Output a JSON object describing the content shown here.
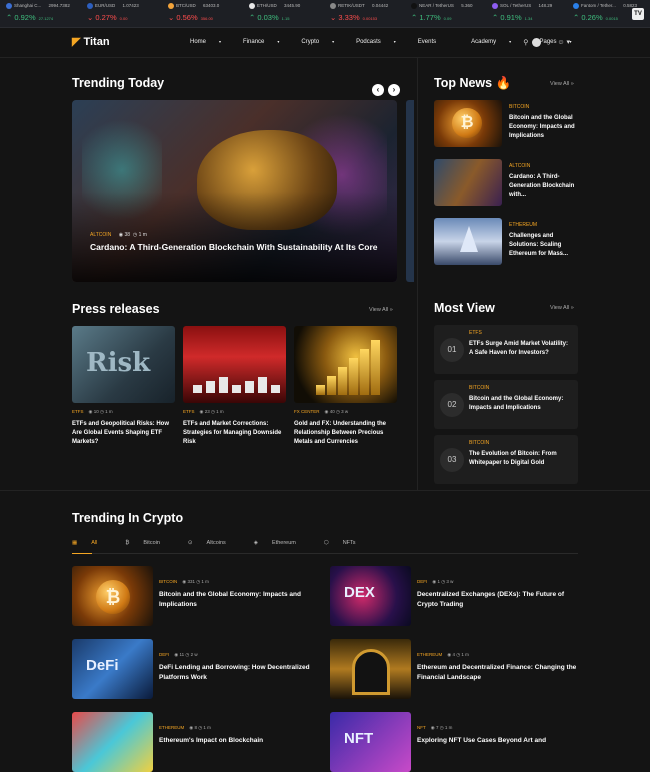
{
  "ticker": [
    {
      "name": "Shanghai C...",
      "price": "2994.7382",
      "change": "0.92%",
      "delta": "27.1274",
      "dir": "up",
      "color": "#3b6fd4"
    },
    {
      "name": "EUR/USD",
      "price": "1.07423",
      "change": "0.27%",
      "delta": "0.00",
      "dir": "dn",
      "color": "#2d5fbf"
    },
    {
      "name": "BTC/USD",
      "price": "63403.0",
      "change": "0.56%",
      "delta": "356.00",
      "dir": "dn",
      "color": "#f2a33a"
    },
    {
      "name": "ETH/USD",
      "price": "3445.90",
      "change": "0.03%",
      "delta": "1.15",
      "dir": "up",
      "color": "#e7e7e7"
    },
    {
      "name": "RETIK/USDT",
      "price": "0.04442",
      "change": "3.33%",
      "delta": "0.00153",
      "dir": "dn",
      "color": "#888"
    },
    {
      "name": "NEAR / TetherUS",
      "price": "5.360",
      "change": "1.77%",
      "delta": "0.09",
      "dir": "up",
      "color": "#111"
    },
    {
      "name": "SOL / TetherUS",
      "price": "148.29",
      "change": "0.91%",
      "delta": "1.34",
      "dir": "up",
      "color": "#8d5cf0"
    },
    {
      "name": "Fantom / Tether...",
      "price": "0.5823",
      "change": "0.26%",
      "delta": "0.0015",
      "dir": "up",
      "color": "#2a7fe8"
    }
  ],
  "tv_logo": "TV",
  "brand": "Titan",
  "nav": [
    "Home",
    "Finance",
    "Crypto",
    "Podcasts",
    "Events",
    "Academy",
    "JI Pages"
  ],
  "nav_suffix": [
    "▾",
    "▾",
    "▾",
    "▾",
    "",
    "▾",
    "▾"
  ],
  "trending_today": {
    "heading": "Trending Today",
    "arrows": [
      "‹",
      "›"
    ],
    "hero": {
      "category": "ALTCOIN",
      "views": "38",
      "time": "1 m",
      "title": "Cardano: A Third-Generation Blockchain With Sustainability At Its Core"
    }
  },
  "top_news": {
    "heading": "Top News",
    "fire": "🔥",
    "view_all": "View All",
    "items": [
      {
        "category": "BITCOIN",
        "title": "Bitcoin and the Global Economy: Impacts and Implications"
      },
      {
        "category": "ALTCOIN",
        "title": "Cardano: A Third-Generation Blockchain with..."
      },
      {
        "category": "ETHEREUM",
        "title": "Challenges and Solutions: Scaling Ethereum for Mass..."
      }
    ]
  },
  "press": {
    "heading": "Press releases",
    "view_all": "View All",
    "items": [
      {
        "category": "ETFS",
        "views": "10",
        "time": "1 m",
        "title": "ETFs and Geopolitical Risks: How Are Global Events Shaping ETF Markets?",
        "img_text": "Risk"
      },
      {
        "category": "ETFS",
        "views": "23",
        "time": "1 m",
        "title": "ETFs and Market Corrections: Strategies for Managing Downside Risk"
      },
      {
        "category": "FX CENTER",
        "views": "40",
        "time": "3 w",
        "title": "Gold and FX: Understanding the Relationship Between Precious Metals and Currencies"
      }
    ]
  },
  "most_view": {
    "heading": "Most View",
    "view_all": "View All",
    "items": [
      {
        "num": "01",
        "category": "ETFS",
        "title": "ETFs Surge Amid Market Volatility: A Safe Haven for Investors?"
      },
      {
        "num": "02",
        "category": "BITCOIN",
        "title": "Bitcoin and the Global Economy: Impacts and Implications"
      },
      {
        "num": "03",
        "category": "BITCOIN",
        "title": "The Evolution of Bitcoin: From Whitepaper to Digital Gold"
      }
    ]
  },
  "crypto": {
    "heading": "Trending In Crypto",
    "tabs": [
      "All",
      "Bitcoin",
      "Altcoins",
      "Ethereum",
      "NFTs"
    ],
    "items": [
      {
        "category": "BITCOIN",
        "views": "331",
        "time": "1 m",
        "title": "Bitcoin and the Global Economy: Impacts and Implications"
      },
      {
        "category": "DEFI",
        "views": "1",
        "time": "3 w",
        "title": "Decentralized Exchanges (DEXs): The Future of Crypto Trading",
        "img_text": "DEX"
      },
      {
        "category": "DEFI",
        "views": "11",
        "time": "2 w",
        "title": "DeFi Lending and Borrowing: How Decentralized Platforms Work",
        "img_text": "DeFi"
      },
      {
        "category": "ETHEREUM",
        "views": "4",
        "time": "1 m",
        "title": "Ethereum and Decentralized Finance: Changing the Financial Landscape"
      },
      {
        "category": "ETHEREUM",
        "views": "8",
        "time": "1 m",
        "title": "Ethereum's Impact on Blockchain"
      },
      {
        "category": "NFT",
        "views": "7",
        "time": "1 m",
        "title": "Exploring NFT Use Cases Beyond Art and",
        "img_text": "NFT"
      }
    ]
  },
  "icons": {
    "eye": "◉",
    "clock": "◷",
    "search": "⚲",
    "user": "👤"
  }
}
